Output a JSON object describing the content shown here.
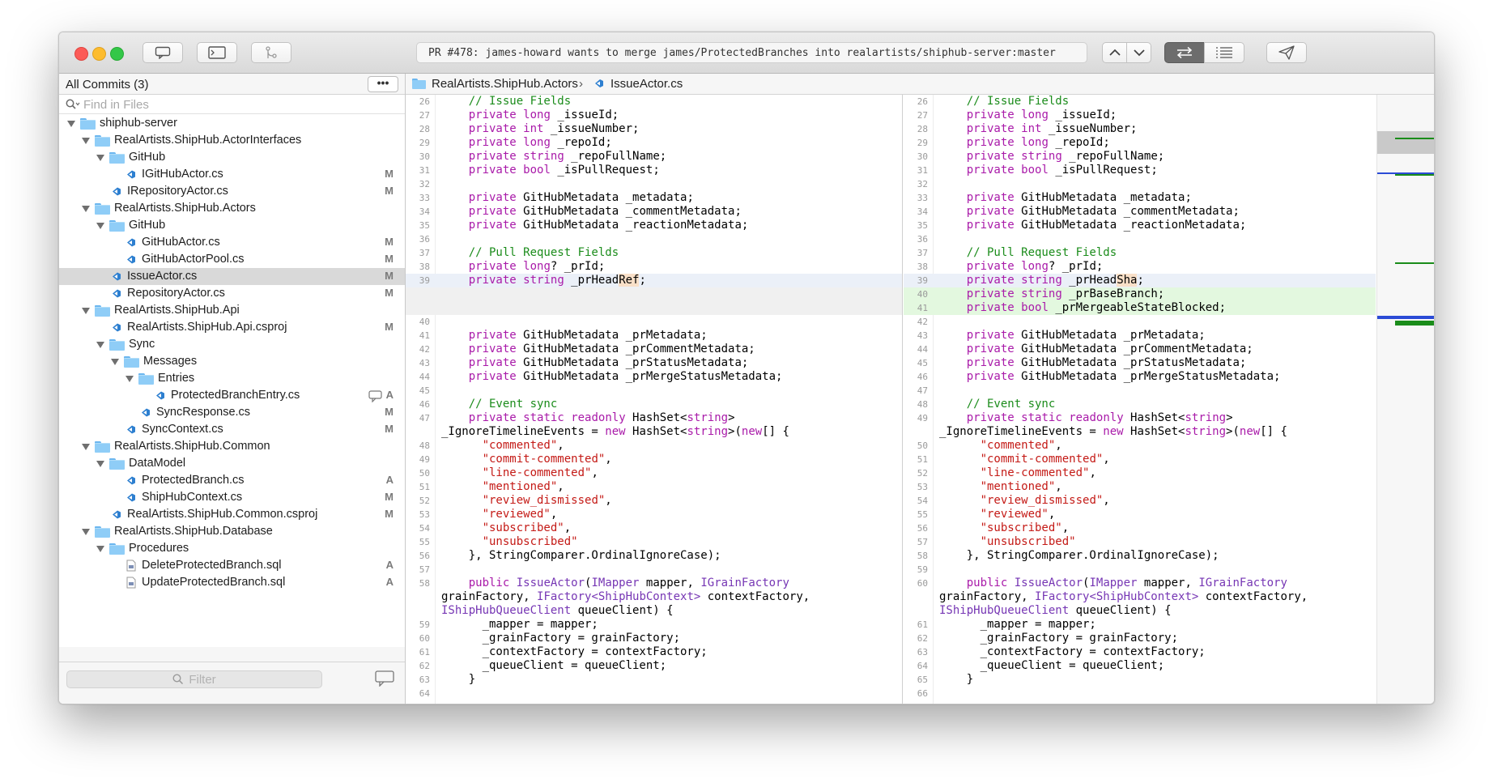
{
  "window": {
    "title": "PR #478: james-howard wants to merge james/ProtectedBranches into realartists/shiphub-server:master"
  },
  "sidebar": {
    "commits_label": "All Commits (3)",
    "more_label": "•••",
    "find_placeholder": "Find in Files",
    "filter_placeholder": "Filter",
    "tree": [
      {
        "label": "shiphub-server",
        "kind": "folder",
        "depth": 0,
        "status": ""
      },
      {
        "label": "RealArtists.ShipHub.ActorInterfaces",
        "kind": "folder",
        "depth": 1,
        "status": ""
      },
      {
        "label": "GitHub",
        "kind": "folder",
        "depth": 2,
        "status": ""
      },
      {
        "label": "IGitHubActor.cs",
        "kind": "file",
        "depth": 3,
        "status": "M"
      },
      {
        "label": "IRepositoryActor.cs",
        "kind": "file",
        "depth": 2,
        "status": "M"
      },
      {
        "label": "RealArtists.ShipHub.Actors",
        "kind": "folder",
        "depth": 1,
        "status": ""
      },
      {
        "label": "GitHub",
        "kind": "folder",
        "depth": 2,
        "status": ""
      },
      {
        "label": "GitHubActor.cs",
        "kind": "file",
        "depth": 3,
        "status": "M"
      },
      {
        "label": "GitHubActorPool.cs",
        "kind": "file",
        "depth": 3,
        "status": "M"
      },
      {
        "label": "IssueActor.cs",
        "kind": "file",
        "depth": 2,
        "status": "M",
        "selected": true
      },
      {
        "label": "RepositoryActor.cs",
        "kind": "file",
        "depth": 2,
        "status": "M"
      },
      {
        "label": "RealArtists.ShipHub.Api",
        "kind": "folder",
        "depth": 1,
        "status": ""
      },
      {
        "label": "RealArtists.ShipHub.Api.csproj",
        "kind": "file",
        "depth": 2,
        "status": "M"
      },
      {
        "label": "Sync",
        "kind": "folder",
        "depth": 2,
        "status": ""
      },
      {
        "label": "Messages",
        "kind": "folder",
        "depth": 3,
        "status": ""
      },
      {
        "label": "Entries",
        "kind": "folder",
        "depth": 4,
        "status": ""
      },
      {
        "label": "ProtectedBranchEntry.cs",
        "kind": "file",
        "depth": 5,
        "status": "A",
        "comment": true
      },
      {
        "label": "SyncResponse.cs",
        "kind": "file",
        "depth": 4,
        "status": "M"
      },
      {
        "label": "SyncContext.cs",
        "kind": "file",
        "depth": 3,
        "status": "M"
      },
      {
        "label": "RealArtists.ShipHub.Common",
        "kind": "folder",
        "depth": 1,
        "status": ""
      },
      {
        "label": "DataModel",
        "kind": "folder",
        "depth": 2,
        "status": ""
      },
      {
        "label": "ProtectedBranch.cs",
        "kind": "file",
        "depth": 3,
        "status": "A"
      },
      {
        "label": "ShipHubContext.cs",
        "kind": "file",
        "depth": 3,
        "status": "M"
      },
      {
        "label": "RealArtists.ShipHub.Common.csproj",
        "kind": "file",
        "depth": 2,
        "status": "M"
      },
      {
        "label": "RealArtists.ShipHub.Database",
        "kind": "folder",
        "depth": 1,
        "status": ""
      },
      {
        "label": "Procedures",
        "kind": "folder",
        "depth": 2,
        "status": ""
      },
      {
        "label": "DeleteProtectedBranch.sql",
        "kind": "sql",
        "depth": 3,
        "status": "A"
      },
      {
        "label": "UpdateProtectedBranch.sql",
        "kind": "sql",
        "depth": 3,
        "status": "A"
      }
    ]
  },
  "breadcrumb": {
    "folder": "RealArtists.ShipHub.Actors",
    "separator": "›",
    "file": "IssueActor.cs"
  },
  "diff": {
    "left": [
      {
        "n": "26",
        "t": "    // Issue Fields"
      },
      {
        "n": "27",
        "t": "    private long _issueId;"
      },
      {
        "n": "28",
        "t": "    private int _issueNumber;"
      },
      {
        "n": "29",
        "t": "    private long _repoId;"
      },
      {
        "n": "30",
        "t": "    private string _repoFullName;"
      },
      {
        "n": "31",
        "t": "    private bool _isPullRequest;"
      },
      {
        "n": "32",
        "t": ""
      },
      {
        "n": "33",
        "t": "    private GitHubMetadata _metadata;"
      },
      {
        "n": "34",
        "t": "    private GitHubMetadata _commentMetadata;"
      },
      {
        "n": "35",
        "t": "    private GitHubMetadata _reactionMetadata;"
      },
      {
        "n": "36",
        "t": ""
      },
      {
        "n": "37",
        "t": "    // Pull Request Fields"
      },
      {
        "n": "38",
        "t": "    private long? _prId;"
      },
      {
        "n": "39",
        "t": "    private string _prHeadRef;",
        "hl": "blue"
      },
      {
        "n": "",
        "t": "",
        "hl": "gray"
      },
      {
        "n": "",
        "t": "",
        "hl": "gray"
      },
      {
        "n": "40",
        "t": ""
      },
      {
        "n": "41",
        "t": "    private GitHubMetadata _prMetadata;"
      },
      {
        "n": "42",
        "t": "    private GitHubMetadata _prCommentMetadata;"
      },
      {
        "n": "43",
        "t": "    private GitHubMetadata _prStatusMetadata;"
      },
      {
        "n": "44",
        "t": "    private GitHubMetadata _prMergeStatusMetadata;"
      },
      {
        "n": "45",
        "t": ""
      },
      {
        "n": "46",
        "t": "    // Event sync"
      },
      {
        "n": "47",
        "t": "    private static readonly HashSet<string>"
      },
      {
        "n": "",
        "t": "_IgnoreTimelineEvents = new HashSet<string>(new[] {"
      },
      {
        "n": "48",
        "t": "      \"commented\","
      },
      {
        "n": "49",
        "t": "      \"commit-commented\","
      },
      {
        "n": "50",
        "t": "      \"line-commented\","
      },
      {
        "n": "51",
        "t": "      \"mentioned\","
      },
      {
        "n": "52",
        "t": "      \"review_dismissed\","
      },
      {
        "n": "53",
        "t": "      \"reviewed\","
      },
      {
        "n": "54",
        "t": "      \"subscribed\","
      },
      {
        "n": "55",
        "t": "      \"unsubscribed\""
      },
      {
        "n": "56",
        "t": "    }, StringComparer.OrdinalIgnoreCase);"
      },
      {
        "n": "57",
        "t": ""
      },
      {
        "n": "58",
        "t": "    public IssueActor(IMapper mapper, IGrainFactory"
      },
      {
        "n": "",
        "t": "grainFactory, IFactory<ShipHubContext> contextFactory,"
      },
      {
        "n": "",
        "t": "IShipHubQueueClient queueClient) {"
      },
      {
        "n": "59",
        "t": "      _mapper = mapper;"
      },
      {
        "n": "60",
        "t": "      _grainFactory = grainFactory;"
      },
      {
        "n": "61",
        "t": "      _contextFactory = contextFactory;"
      },
      {
        "n": "62",
        "t": "      _queueClient = queueClient;"
      },
      {
        "n": "63",
        "t": "    }"
      },
      {
        "n": "64",
        "t": ""
      }
    ],
    "right": [
      {
        "n": "26",
        "t": "    // Issue Fields"
      },
      {
        "n": "27",
        "t": "    private long _issueId;"
      },
      {
        "n": "28",
        "t": "    private int _issueNumber;"
      },
      {
        "n": "29",
        "t": "    private long _repoId;"
      },
      {
        "n": "30",
        "t": "    private string _repoFullName;"
      },
      {
        "n": "31",
        "t": "    private bool _isPullRequest;"
      },
      {
        "n": "32",
        "t": ""
      },
      {
        "n": "33",
        "t": "    private GitHubMetadata _metadata;"
      },
      {
        "n": "34",
        "t": "    private GitHubMetadata _commentMetadata;"
      },
      {
        "n": "35",
        "t": "    private GitHubMetadata _reactionMetadata;"
      },
      {
        "n": "36",
        "t": ""
      },
      {
        "n": "37",
        "t": "    // Pull Request Fields"
      },
      {
        "n": "38",
        "t": "    private long? _prId;"
      },
      {
        "n": "39",
        "t": "    private string _prHeadSha;",
        "hl": "blue"
      },
      {
        "n": "40",
        "t": "    private string _prBaseBranch;",
        "hl": "green"
      },
      {
        "n": "41",
        "t": "    private bool _prMergeableStateBlocked;",
        "hl": "green"
      },
      {
        "n": "42",
        "t": ""
      },
      {
        "n": "43",
        "t": "    private GitHubMetadata _prMetadata;"
      },
      {
        "n": "44",
        "t": "    private GitHubMetadata _prCommentMetadata;"
      },
      {
        "n": "45",
        "t": "    private GitHubMetadata _prStatusMetadata;"
      },
      {
        "n": "46",
        "t": "    private GitHubMetadata _prMergeStatusMetadata;"
      },
      {
        "n": "47",
        "t": ""
      },
      {
        "n": "48",
        "t": "    // Event sync"
      },
      {
        "n": "49",
        "t": "    private static readonly HashSet<string>"
      },
      {
        "n": "",
        "t": "_IgnoreTimelineEvents = new HashSet<string>(new[] {"
      },
      {
        "n": "50",
        "t": "      \"commented\","
      },
      {
        "n": "51",
        "t": "      \"commit-commented\","
      },
      {
        "n": "52",
        "t": "      \"line-commented\","
      },
      {
        "n": "53",
        "t": "      \"mentioned\","
      },
      {
        "n": "54",
        "t": "      \"review_dismissed\","
      },
      {
        "n": "55",
        "t": "      \"reviewed\","
      },
      {
        "n": "56",
        "t": "      \"subscribed\","
      },
      {
        "n": "57",
        "t": "      \"unsubscribed\""
      },
      {
        "n": "58",
        "t": "    }, StringComparer.OrdinalIgnoreCase);"
      },
      {
        "n": "59",
        "t": ""
      },
      {
        "n": "60",
        "t": "    public IssueActor(IMapper mapper, IGrainFactory"
      },
      {
        "n": "",
        "t": "grainFactory, IFactory<ShipHubContext> contextFactory,"
      },
      {
        "n": "",
        "t": "IShipHubQueueClient queueClient) {"
      },
      {
        "n": "61",
        "t": "      _mapper = mapper;"
      },
      {
        "n": "62",
        "t": "      _grainFactory = grainFactory;"
      },
      {
        "n": "63",
        "t": "      _contextFactory = contextFactory;"
      },
      {
        "n": "64",
        "t": "      _queueClient = queueClient;"
      },
      {
        "n": "65",
        "t": "    }"
      },
      {
        "n": "66",
        "t": ""
      }
    ]
  },
  "colors": {
    "keyword": "#a91aa9",
    "string": "#c41a16",
    "comment": "#1b8c1b",
    "type": "#7636b4",
    "added_bg": "#e3f8df",
    "changed_bg": "#ebf0f8",
    "selected_row": "#d9d9d9"
  },
  "icons": {
    "toolbar_left": [
      "comment-bubble-icon",
      "terminal-icon",
      "merge-icon"
    ],
    "toolbar_right": [
      "chevron-up-icon",
      "chevron-down-icon",
      "swap-diff-icon",
      "list-icon",
      "send-icon"
    ]
  }
}
